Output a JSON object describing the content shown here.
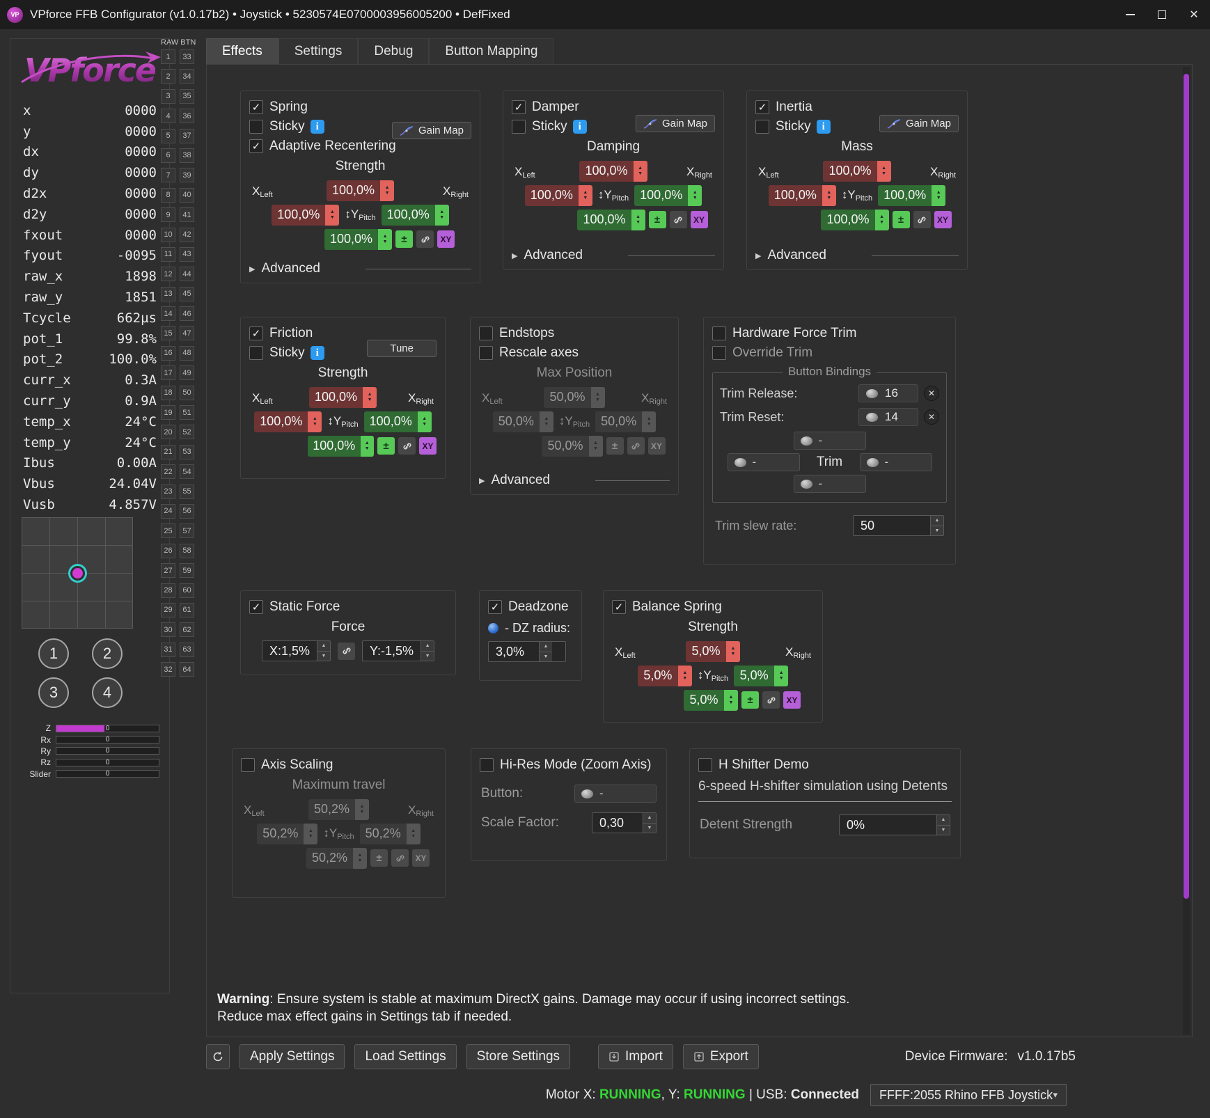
{
  "window": {
    "title": "VPforce FFB Configurator (v1.0.17b2) • Joystick • 5230574E0700003956005200 • DefFixed",
    "app_icon_text": "VP"
  },
  "icons": {
    "check": "✓",
    "close": "✕",
    "info": "i",
    "updown": "↕",
    "advanced_arrow": "▶",
    "combo_arrow": "▾",
    "step_up": "▲",
    "step_down": "▼",
    "plusminus": "±",
    "remove": "✕"
  },
  "sidebar": {
    "logo_text": "VPforce",
    "telemetry": [
      {
        "label": "x",
        "value": "0000"
      },
      {
        "label": "y",
        "value": "0000"
      },
      {
        "label": "dx",
        "value": "0000"
      },
      {
        "label": "dy",
        "value": "0000"
      },
      {
        "label": "d2x",
        "value": "0000"
      },
      {
        "label": "d2y",
        "value": "0000"
      },
      {
        "label": "fxout",
        "value": "0000"
      },
      {
        "label": "fyout",
        "value": "-0095"
      },
      {
        "label": "raw_x",
        "value": "1898"
      },
      {
        "label": "raw_y",
        "value": "1851"
      },
      {
        "label": "Tcycle",
        "value": "662µs"
      },
      {
        "label": "pot_1",
        "value": "99.8%"
      },
      {
        "label": "pot_2",
        "value": "100.0%"
      },
      {
        "label": "curr_x",
        "value": "0.3A"
      },
      {
        "label": "curr_y",
        "value": "0.9A"
      },
      {
        "label": "temp_x",
        "value": "24°C"
      },
      {
        "label": "temp_y",
        "value": "24°C"
      },
      {
        "label": "Ibus",
        "value": "0.00A"
      },
      {
        "label": "Vbus",
        "value": "24.04V"
      },
      {
        "label": "Vusb",
        "value": "4.857V"
      }
    ],
    "joy_buttons": [
      "1",
      "2",
      "3",
      "4"
    ],
    "axes": [
      {
        "label": "Z",
        "value": "0",
        "fill": 47
      },
      {
        "label": "Rx",
        "value": "0",
        "fill": 0
      },
      {
        "label": "Ry",
        "value": "0",
        "fill": 0
      },
      {
        "label": "Rz",
        "value": "0",
        "fill": 0
      },
      {
        "label": "Slider",
        "value": "0",
        "fill": 0
      }
    ]
  },
  "raw_buttons": {
    "header": "RAW BTN",
    "col1_start": 1,
    "col1_end": 32,
    "col2_start": 33,
    "col2_end": 64
  },
  "tabs": [
    {
      "label": "Effects",
      "active": true
    },
    {
      "label": "Settings",
      "active": false
    },
    {
      "label": "Debug",
      "active": false
    },
    {
      "label": "Button Mapping",
      "active": false
    }
  ],
  "effects": {
    "spring": {
      "title": "Spring",
      "checked": true,
      "sticky": {
        "label": "Sticky",
        "checked": false
      },
      "gain_map_label": "Gain Map",
      "adaptive": {
        "label": "Adaptive Recentering",
        "checked": true
      },
      "advanced_label": "Advanced",
      "cross": {
        "section": "Strength",
        "disabled": false,
        "xy_label": "XY",
        "labels": {
          "x": "X",
          "left": "Left",
          "right": "Right",
          "y": "Y",
          "pitch": "Pitch"
        },
        "values": {
          "top": "100,0%",
          "left": "100,0%",
          "right": "100,0%",
          "bottom": "100,0%"
        }
      }
    },
    "damper": {
      "title": "Damper",
      "checked": true,
      "sticky": {
        "label": "Sticky",
        "checked": false
      },
      "gain_map_label": "Gain Map",
      "advanced_label": "Advanced",
      "cross": {
        "section": "Damping",
        "disabled": false,
        "xy_label": "XY",
        "labels": {
          "x": "X",
          "left": "Left",
          "right": "Right",
          "y": "Y",
          "pitch": "Pitch"
        },
        "values": {
          "top": "100,0%",
          "left": "100,0%",
          "right": "100,0%",
          "bottom": "100,0%"
        }
      }
    },
    "inertia": {
      "title": "Inertia",
      "checked": true,
      "sticky": {
        "label": "Sticky",
        "checked": false
      },
      "gain_map_label": "Gain Map",
      "advanced_label": "Advanced",
      "cross": {
        "section": "Mass",
        "disabled": false,
        "xy_label": "XY",
        "labels": {
          "x": "X",
          "left": "Left",
          "right": "Right",
          "y": "Y",
          "pitch": "Pitch"
        },
        "values": {
          "top": "100,0%",
          "left": "100,0%",
          "right": "100,0%",
          "bottom": "100,0%"
        }
      }
    },
    "friction": {
      "title": "Friction",
      "checked": true,
      "sticky": {
        "label": "Sticky",
        "checked": false
      },
      "tune_label": "Tune",
      "cross": {
        "section": "Strength",
        "disabled": false,
        "xy_label": "XY",
        "labels": {
          "x": "X",
          "left": "Left",
          "right": "Right",
          "y": "Y",
          "pitch": "Pitch"
        },
        "values": {
          "top": "100,0%",
          "left": "100,0%",
          "right": "100,0%",
          "bottom": "100,0%"
        }
      }
    },
    "endstops": {
      "title": "Endstops",
      "checked": false,
      "rescale": {
        "label": "Rescale axes",
        "checked": false
      },
      "advanced_label": "Advanced",
      "cross": {
        "section": "Max Position",
        "disabled": true,
        "xy_label": "XY",
        "labels": {
          "x": "X",
          "left": "Left",
          "right": "Right",
          "y": "Y",
          "pitch": "Pitch"
        },
        "values": {
          "top": "50,0%",
          "left": "50,0%",
          "right": "50,0%",
          "bottom": "50,0%"
        }
      }
    },
    "hardware_trim": {
      "title": "Hardware Force Trim",
      "checked": false,
      "override": {
        "label": "Override Trim",
        "checked": false
      },
      "group_title": "Button Bindings",
      "release_label": "Trim Release:",
      "release_value": "16",
      "reset_label": "Trim Reset:",
      "reset_value": "14",
      "center_label": "Trim",
      "slot_placeholder": "-",
      "slew_label": "Trim slew rate:",
      "slew_value": "50"
    },
    "static_force": {
      "title": "Static Force",
      "checked": true,
      "section": "Force",
      "x_value": "X:1,5%",
      "y_value": "Y:-1,5%"
    },
    "deadzone": {
      "title": "Deadzone",
      "checked": true,
      "radius_label": "- DZ radius:",
      "radius_value": "3,0%"
    },
    "balance_spring": {
      "title": "Balance Spring",
      "checked": true,
      "cross": {
        "section": "Strength",
        "disabled": false,
        "xy_label": "XY",
        "labels": {
          "x": "X",
          "left": "Left",
          "right": "Right",
          "y": "Y",
          "pitch": "Pitch"
        },
        "values": {
          "top": "5,0%",
          "left": "5,0%",
          "right": "5,0%",
          "bottom": "5,0%"
        }
      }
    },
    "axis_scaling": {
      "title": "Axis Scaling",
      "checked": false,
      "cross": {
        "section": "Maximum travel",
        "disabled": true,
        "xy_label": "XY",
        "labels": {
          "x": "X",
          "left": "Left",
          "right": "Right",
          "y": "Y",
          "pitch": "Pitch"
        },
        "values": {
          "top": "50,2%",
          "left": "50,2%",
          "right": "50,2%",
          "bottom": "50,2%"
        }
      }
    },
    "hires": {
      "title": "Hi-Res Mode (Zoom Axis)",
      "checked": false,
      "button_label": "Button:",
      "button_value": "-",
      "scale_label": "Scale Factor:",
      "scale_value": "0,30"
    },
    "hshifter": {
      "title": "H Shifter Demo",
      "checked": false,
      "description": "6-speed H-shifter simulation using Detents",
      "detent_label": "Detent Strength",
      "detent_value": "0%"
    }
  },
  "warning": {
    "prefix": "Warning",
    "line1": ": Ensure system is stable at maximum DirectX gains. Damage may occur if using incorrect settings.",
    "line2": "Reduce max effect gains in Settings tab if needed."
  },
  "footer": {
    "apply": "Apply Settings",
    "load": "Load Settings",
    "store": "Store Settings",
    "import": "Import",
    "export": "Export",
    "firmware_label": "Device Firmware:",
    "firmware_value": "v1.0.17b5"
  },
  "statusbar": {
    "motor_x_label": "Motor X: ",
    "motor_x_value": "RUNNING",
    "motor_y_label": ", Y: ",
    "motor_y_value": "RUNNING",
    "usb_label": " | USB: ",
    "usb_value": "Connected",
    "device_select": "FFFF:2055 Rhino FFB Joystick"
  },
  "colors": {
    "accent_magenta": "#c13bd0",
    "scroll_purple": "#a13bcb",
    "running_green": "#35d835",
    "spin_red_bg": "#6e3434",
    "spin_red_btn": "#e2625c",
    "spin_green_bg": "#2f6b33",
    "spin_green_btn": "#57c957",
    "xy_purple": "#b55fd8",
    "info_blue": "#2d9bf0"
  }
}
